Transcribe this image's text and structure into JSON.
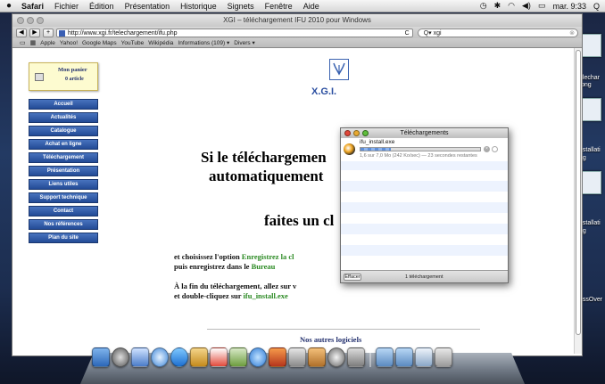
{
  "menubar": {
    "apple": "",
    "app": "Safari",
    "items": [
      "Fichier",
      "Édition",
      "Présentation",
      "Historique",
      "Signets",
      "Fenêtre",
      "Aide"
    ],
    "clock": "mar. 9:33",
    "search_glyph": "Q"
  },
  "window": {
    "title": "XGI – téléchargement IFU 2010 pour Windows",
    "back": "◀",
    "forward": "▶",
    "add": "+",
    "url": "http://www.xgi.fr/telechargement/ifu.php",
    "reload": "C",
    "search_value": "Q▾ xgi",
    "search_clear": "⊗"
  },
  "bookmarks": {
    "icons": [
      "▭",
      "▦"
    ],
    "items": [
      "Apple",
      "Yahoo!",
      "Google Maps",
      "YouTube",
      "Wikipédia",
      "Informations (109) ▾",
      "Divers ▾"
    ]
  },
  "page": {
    "cart_title": "Mon panier",
    "cart_count": "0 article",
    "nav": [
      "Accueil",
      "Actualités",
      "Catalogue",
      "Achat en ligne",
      "Téléchargement",
      "Présentation",
      "Liens utiles",
      "Support technique",
      "Contact",
      "Nos références",
      "Plan du site"
    ],
    "brand": "X.G.I.",
    "big1": "Si le téléchargemen",
    "big2": "automatiquement",
    "big3": "faites un cl",
    "p1_a": "et choisissez l'option ",
    "p1_b": "Enregistrez la cl",
    "p2_a": "puis enregistrez dans le ",
    "p2_b": "Bureau",
    "p3": "À la fin du téléchargement, allez sur v",
    "p4_a": "et double-cliquez sur ",
    "p4_b": "ifu_install.exe",
    "others": "Nos autres logiciels"
  },
  "downloads": {
    "title": "Téléchargements",
    "file": "ifu_install.exe",
    "progress": 0.25,
    "status": "1,6 sur 7,0 Mo (242 Ko/sec) — 23 secondes restantes",
    "stop": "×",
    "clear": "Effacer",
    "count": "1 téléchargement"
  },
  "desktop": {
    "labels": [
      "elechar",
      ".png",
      "nstallati",
      "ng",
      "nstallati",
      "ng",
      "ossOver"
    ]
  },
  "colors": {
    "nav_blue": "#234b96",
    "brand_blue": "#2a4ea0",
    "link_green": "#2b8a23",
    "title_navy": "#23306e"
  }
}
